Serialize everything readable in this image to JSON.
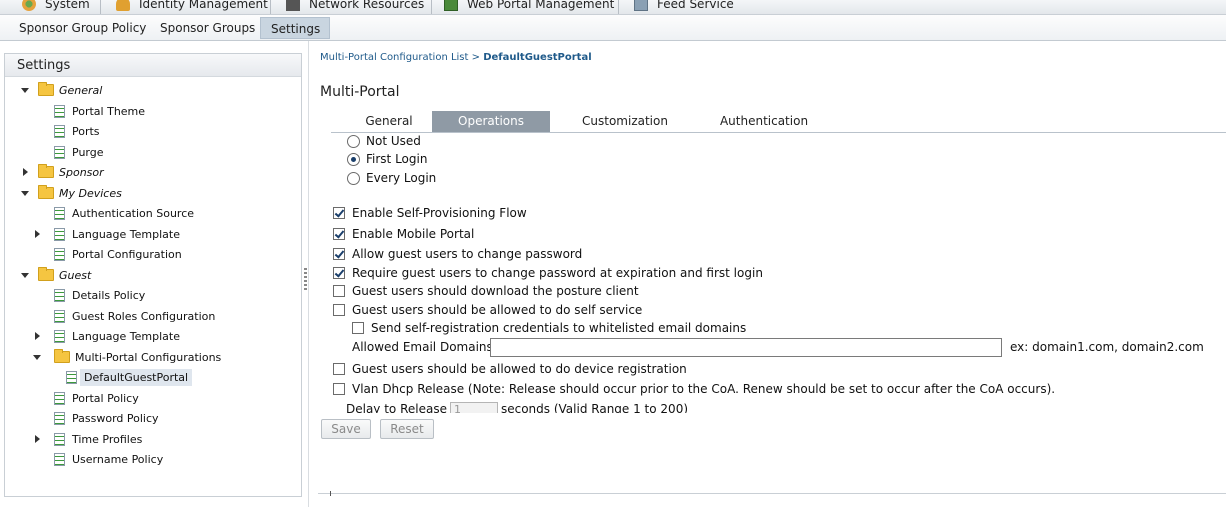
{
  "top_menu": [
    {
      "label": "System",
      "icon": "system-icon"
    },
    {
      "label": "Identity Management",
      "icon": "identity-icon"
    },
    {
      "label": "Network Resources",
      "icon": "network-icon"
    },
    {
      "label": "Web Portal Management",
      "icon": "web-portal-icon"
    },
    {
      "label": "Feed Service",
      "icon": "feed-icon"
    }
  ],
  "sub_nav": [
    {
      "label": "Sponsor Group Policy",
      "active": false
    },
    {
      "label": "Sponsor Groups",
      "active": false
    },
    {
      "label": "Settings",
      "active": true
    }
  ],
  "left_panel": {
    "title": "Settings",
    "tree": [
      {
        "label": "General",
        "type": "folder",
        "expanded": true
      },
      {
        "label": "Portal Theme",
        "type": "leaf"
      },
      {
        "label": "Ports",
        "type": "leaf"
      },
      {
        "label": "Purge",
        "type": "leaf"
      },
      {
        "label": "Sponsor",
        "type": "folder",
        "expanded": false
      },
      {
        "label": "My Devices",
        "type": "folder",
        "expanded": true
      },
      {
        "label": "Authentication Source",
        "type": "leaf"
      },
      {
        "label": "Language Template",
        "type": "leaf-collapsed"
      },
      {
        "label": "Portal Configuration",
        "type": "leaf"
      },
      {
        "label": "Guest",
        "type": "folder",
        "expanded": true
      },
      {
        "label": "Details Policy",
        "type": "leaf"
      },
      {
        "label": "Guest Roles Configuration",
        "type": "leaf"
      },
      {
        "label": "Language Template",
        "type": "leaf-collapsed"
      },
      {
        "label": "Multi-Portal Configurations",
        "type": "leaf-expanded"
      },
      {
        "label": "DefaultGuestPortal",
        "type": "leaf",
        "selected": true
      },
      {
        "label": "Portal Policy",
        "type": "leaf"
      },
      {
        "label": "Password Policy",
        "type": "leaf"
      },
      {
        "label": "Time Profiles",
        "type": "leaf-collapsed"
      },
      {
        "label": "Username Policy",
        "type": "leaf"
      }
    ]
  },
  "breadcrumb": {
    "parent": "Multi-Portal Configuration List",
    "separator": ">",
    "current": "DefaultGuestPortal"
  },
  "page_title": "Multi-Portal",
  "tabs": [
    {
      "label": "General",
      "active": false
    },
    {
      "label": "Operations",
      "active": true
    },
    {
      "label": "Customization",
      "active": false
    },
    {
      "label": "Authentication",
      "active": false
    }
  ],
  "radio_options": [
    {
      "label": "Not Used",
      "selected": false
    },
    {
      "label": "First Login",
      "selected": true
    },
    {
      "label": "Every Login",
      "selected": false
    }
  ],
  "checkboxes": [
    {
      "label": "Enable Self-Provisioning Flow",
      "checked": true
    },
    {
      "label": "Enable Mobile Portal",
      "checked": true
    },
    {
      "label": "Allow guest users to change password",
      "checked": true
    },
    {
      "label": "Require guest users to change password at expiration and first login",
      "checked": true
    },
    {
      "label": "Guest users should download the posture client",
      "checked": false
    },
    {
      "label": "Guest users should be allowed to do self service",
      "checked": false
    },
    {
      "label": "Send self-registration credentials to whitelisted email domains",
      "checked": false
    },
    {
      "label": "Guest users should be allowed to do device registration",
      "checked": false
    },
    {
      "label": "Vlan Dhcp Release (Note: Release should occur prior to the CoA. Renew should be set to occur after the CoA occurs).",
      "checked": false
    }
  ],
  "email_domains": {
    "label": "Allowed Email Domains:",
    "value": "",
    "hint": "ex: domain1.com, domain2.com"
  },
  "delay": {
    "label": "Delay to Release",
    "value": "1",
    "suffix": "seconds (Valid Range 1 to 200)"
  },
  "buttons": {
    "save": "Save",
    "reset": "Reset"
  },
  "colors": {
    "active_tab": "#8f9aa5",
    "link": "#1f5a8a",
    "folder": "#f5c541"
  }
}
